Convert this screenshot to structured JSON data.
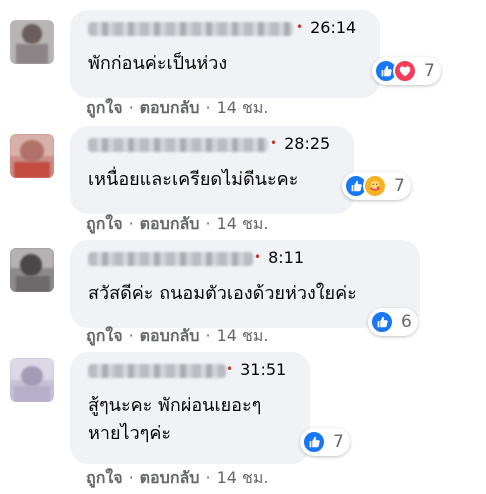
{
  "comments": [
    {
      "stamp": "26:14",
      "text": [
        "พักก่อนค่ะเป็นห่วง"
      ],
      "reactions": [
        "like-icon",
        "love-icon"
      ],
      "count": "7",
      "like_label": "ถูกใจ",
      "reply_label": "ตอบกลับ",
      "time": "14 ชม."
    },
    {
      "stamp": "28:25",
      "text": [
        "เหนื่อยและเครียดไม่ดีนะคะ"
      ],
      "reactions": [
        "like-icon",
        "care-icon"
      ],
      "count": "7",
      "like_label": "ถูกใจ",
      "reply_label": "ตอบกลับ",
      "time": "14 ชม."
    },
    {
      "stamp": "8:11",
      "text": [
        "สวัสดีค่ะ ถนอมตัวเองด้วยห่วงใยค่ะ"
      ],
      "reactions": [
        "like-icon"
      ],
      "count": "6",
      "like_label": "ถูกใจ",
      "reply_label": "ตอบกลับ",
      "time": "14 ชม."
    },
    {
      "stamp": "31:51",
      "text": [
        "สู้ๆนะคะ พักผ่อนเยอะๆ",
        "หายไวๆค่ะ"
      ],
      "reactions": [
        "like-icon"
      ],
      "count": "7",
      "like_label": "ถูกใจ",
      "reply_label": "ตอบกลับ",
      "time": "14 ชม."
    }
  ],
  "colors": {
    "bubble": "#f0f2f5",
    "meta_text": "#65676b",
    "like": "#1877f2",
    "love": "#f33e58",
    "care": "#f7b125"
  }
}
